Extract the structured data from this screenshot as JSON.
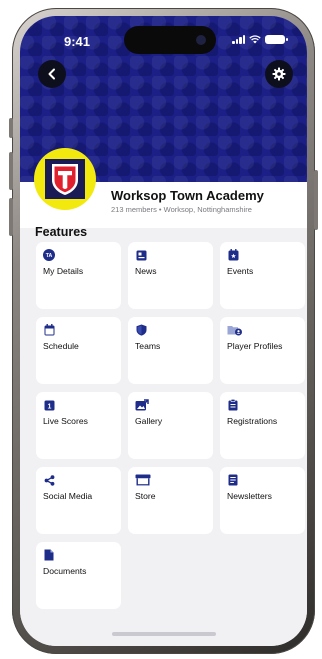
{
  "status_bar": {
    "time": "9:41"
  },
  "header": {
    "back_icon": "chevron-left-icon",
    "settings_icon": "gear-icon",
    "banner_color": "#1b1f86"
  },
  "club": {
    "name": "Worksop Town Academy",
    "subtitle": "213 members • Worksop, Nottinghamshire",
    "logo_ring_color": "#f2e90f",
    "logo_letter": "T"
  },
  "features": {
    "title": "Features",
    "accent_color": "#1f2d8a",
    "items": [
      {
        "label": "My Details",
        "icon": "user-badge-icon",
        "badge": "TA"
      },
      {
        "label": "News",
        "icon": "newspaper-icon"
      },
      {
        "label": "Events",
        "icon": "calendar-star-icon"
      },
      {
        "label": "Schedule",
        "icon": "calendar-icon"
      },
      {
        "label": "Teams",
        "icon": "shield-icon"
      },
      {
        "label": "Player Profiles",
        "icon": "profile-folder-icon"
      },
      {
        "label": "Live Scores",
        "icon": "scoreboard-icon",
        "badge": "1"
      },
      {
        "label": "Gallery",
        "icon": "gallery-icon"
      },
      {
        "label": "Registrations",
        "icon": "clipboard-icon"
      },
      {
        "label": "Social Media",
        "icon": "share-icon"
      },
      {
        "label": "Store",
        "icon": "store-icon"
      },
      {
        "label": "Newsletters",
        "icon": "newsletter-icon"
      },
      {
        "label": "Documents",
        "icon": "document-icon"
      }
    ]
  }
}
